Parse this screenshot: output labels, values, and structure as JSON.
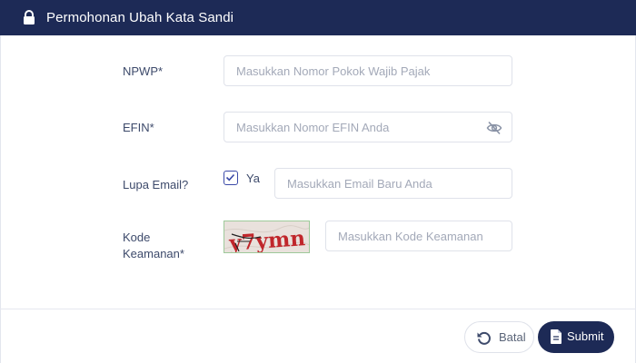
{
  "header": {
    "title": "Permohonan Ubah Kata Sandi",
    "icon": "lock-icon"
  },
  "form": {
    "npwp": {
      "label": "NPWP*",
      "placeholder": "Masukkan Nomor Pokok Wajib Pajak",
      "value": ""
    },
    "efin": {
      "label": "EFIN*",
      "placeholder": "Masukkan Nomor EFIN Anda",
      "value": "",
      "toggle_icon": "eye-slash-icon"
    },
    "lupa_email": {
      "label": "Lupa Email?",
      "checkbox_label": "Ya",
      "checked": true,
      "placeholder": "Masukkan Email Baru Anda",
      "value": ""
    },
    "kode": {
      "label_line1": "Kode",
      "label_line2": "Keamanan*",
      "captcha_text": "y7ymn",
      "placeholder": "Masukkan Kode Keamanan",
      "value": ""
    }
  },
  "footer": {
    "cancel_label": "Batal",
    "cancel_icon": "undo-icon",
    "submit_label": "Submit",
    "submit_icon": "file-icon"
  },
  "colors": {
    "header_bg": "#1d2a56",
    "accent": "#3b4aa8",
    "captcha_text": "#c0262b"
  }
}
